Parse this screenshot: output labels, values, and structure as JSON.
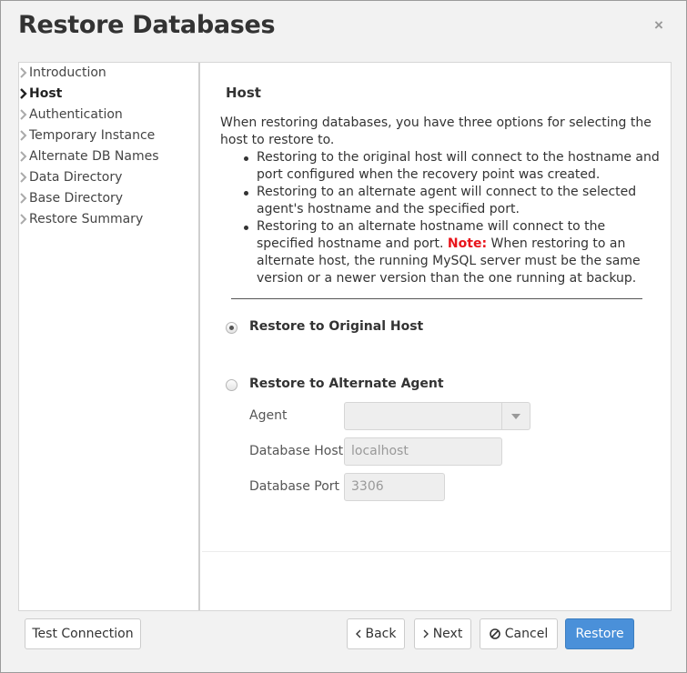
{
  "dialog": {
    "title": "Restore Databases",
    "close_glyph": "×"
  },
  "sidebar": {
    "items": [
      {
        "label": "Introduction",
        "active": false
      },
      {
        "label": "Host",
        "active": true
      },
      {
        "label": "Authentication",
        "active": false
      },
      {
        "label": "Temporary Instance",
        "active": false
      },
      {
        "label": "Alternate DB Names",
        "active": false
      },
      {
        "label": "Data Directory",
        "active": false
      },
      {
        "label": "Base Directory",
        "active": false
      },
      {
        "label": "Restore Summary",
        "active": false
      }
    ]
  },
  "main": {
    "title": "Host",
    "intro": "When restoring databases, you have three options for selecting the host to restore to.",
    "bullets": [
      "Restoring to the original host will connect to the hostname and port configured when the recovery point was created.",
      "Restoring to an alternate agent will connect to the selected agent's hostname and the specified port."
    ],
    "bullet3_before": "Restoring to an alternate hostname will connect to the specified hostname and port.",
    "note_label": "Note:",
    "bullet3_after": "When restoring to an alternate host, the running MySQL server must be the same version or a newer version than the one running at backup.",
    "options": {
      "original_host_label": "Restore to Original Host",
      "original_host_selected": true,
      "alternate_agent_label": "Restore to Alternate Agent",
      "alternate_agent_selected": false
    },
    "fields": {
      "agent_label": "Agent",
      "agent_value": "",
      "db_host_label": "Database Host",
      "db_host_value": "localhost",
      "db_port_label": "Database Port",
      "db_port_value": "3306"
    }
  },
  "footer": {
    "test_connection_label": "Test Connection",
    "back_label": "Back",
    "next_label": "Next",
    "cancel_label": "Cancel",
    "restore_label": "Restore"
  },
  "colors": {
    "accent": "#4a90d9",
    "note": "#e8141b"
  },
  "icons": {
    "nav_chevron": "chevron-right-icon",
    "back": "chevron-left-icon",
    "next": "chevron-right-icon",
    "cancel": "ban-icon",
    "select": "caret-down-icon",
    "close": "close-icon"
  }
}
